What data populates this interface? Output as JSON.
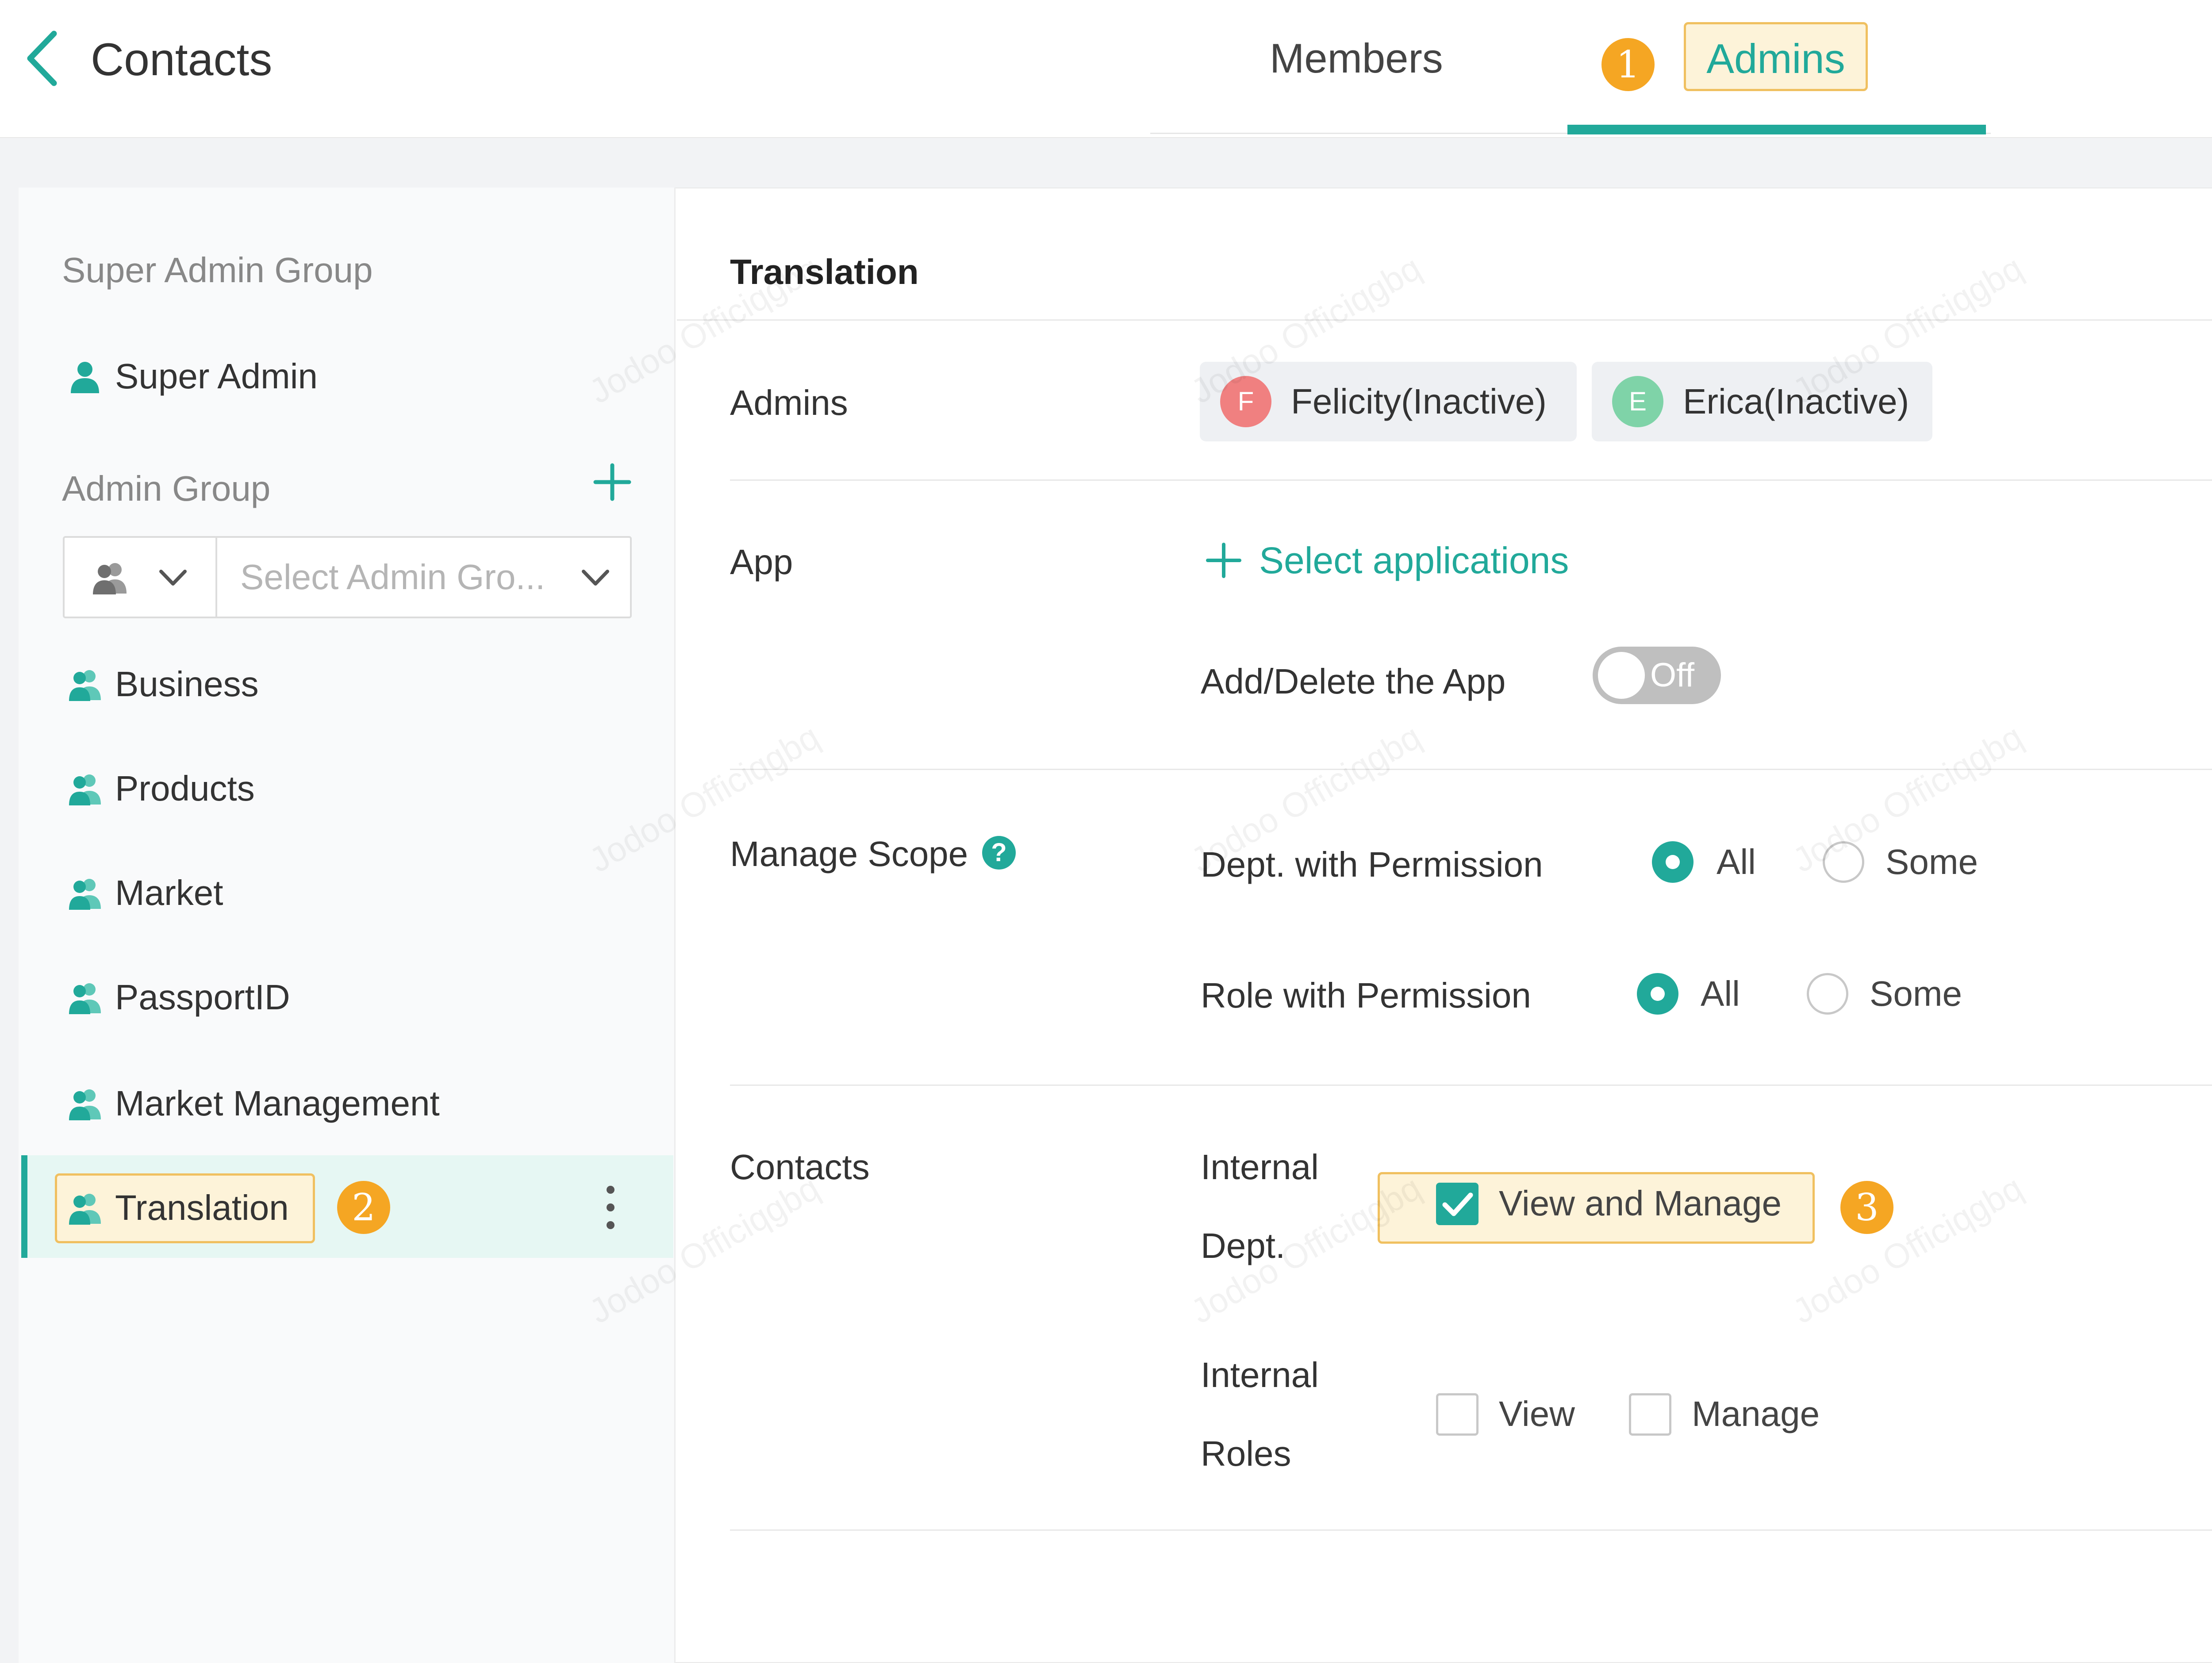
{
  "header": {
    "title": "Contacts",
    "tabs": [
      {
        "label": "Members",
        "active": false
      },
      {
        "label": "Admins",
        "active": true
      }
    ],
    "accent_color": "#21a99a"
  },
  "callouts": [
    "1",
    "2",
    "3"
  ],
  "sidebar": {
    "super_admin_heading": "Super Admin Group",
    "super_admin_item": "Super Admin",
    "admin_group_heading": "Admin Group",
    "group_select_placeholder": "Select Admin Gro...",
    "groups": [
      {
        "label": "Business"
      },
      {
        "label": "Products"
      },
      {
        "label": "Market"
      },
      {
        "label": "PassportID"
      },
      {
        "label": "Market Management"
      },
      {
        "label": "Translation",
        "selected": true
      }
    ]
  },
  "content": {
    "title": "Translation",
    "admins": {
      "label": "Admins",
      "people": [
        {
          "initial": "F",
          "name": "Felicity(Inactive)",
          "color": "#f08080"
        },
        {
          "initial": "E",
          "name": "Erica(Inactive)",
          "color": "#7fd3a8"
        }
      ]
    },
    "app": {
      "label": "App",
      "select_link": "Select applications",
      "toggle_label": "Add/Delete the App",
      "toggle_state": "Off"
    },
    "manage_scope": {
      "label": "Manage Scope",
      "help": "?",
      "dept_label": "Dept. with Permission",
      "role_label": "Role with Permission",
      "option_all": "All",
      "option_some": "Some",
      "dept_selected": "All",
      "role_selected": "All"
    },
    "contacts": {
      "label": "Contacts",
      "internal_dept_line1": "Internal",
      "internal_dept_line2": "Dept.",
      "view_and_manage": "View and Manage",
      "view_and_manage_checked": true,
      "internal_roles_line1": "Internal",
      "internal_roles_line2": "Roles",
      "view": "View",
      "manage": "Manage",
      "view_checked": false,
      "manage_checked": false
    }
  },
  "watermark_text": "Jodoo Officiqgbq"
}
